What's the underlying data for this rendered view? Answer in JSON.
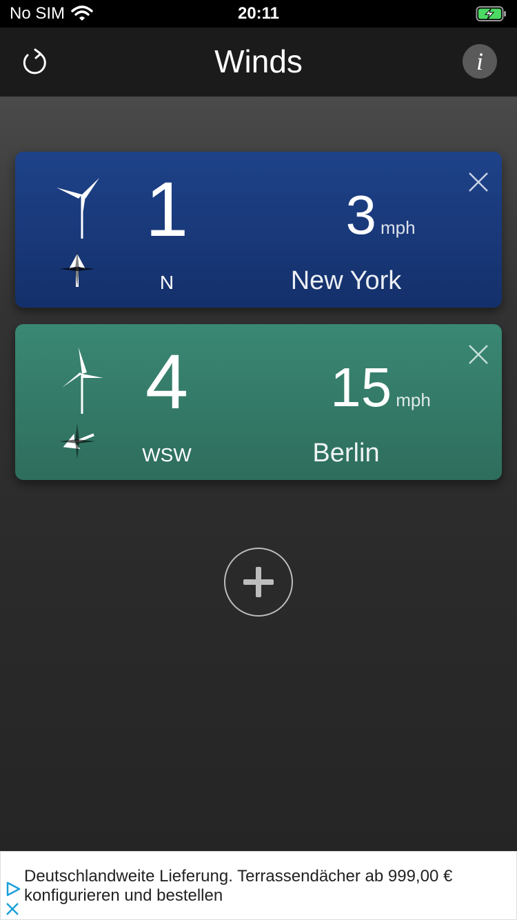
{
  "status_bar": {
    "carrier": "No SIM",
    "time": "20:11"
  },
  "nav": {
    "title": "Winds"
  },
  "locations": [
    {
      "beaufort": "1",
      "direction": "N",
      "speed": "3",
      "unit": "mph",
      "city": "New York",
      "color": "#1c3f85"
    },
    {
      "beaufort": "4",
      "direction": "WSW",
      "speed": "15",
      "unit": "mph",
      "city": "Berlin",
      "color": "#35806b"
    }
  ],
  "ad": {
    "text": "Deutschlandweite Lieferung. Terrassendächer ab 999,00 € konfigurieren und bestellen"
  }
}
